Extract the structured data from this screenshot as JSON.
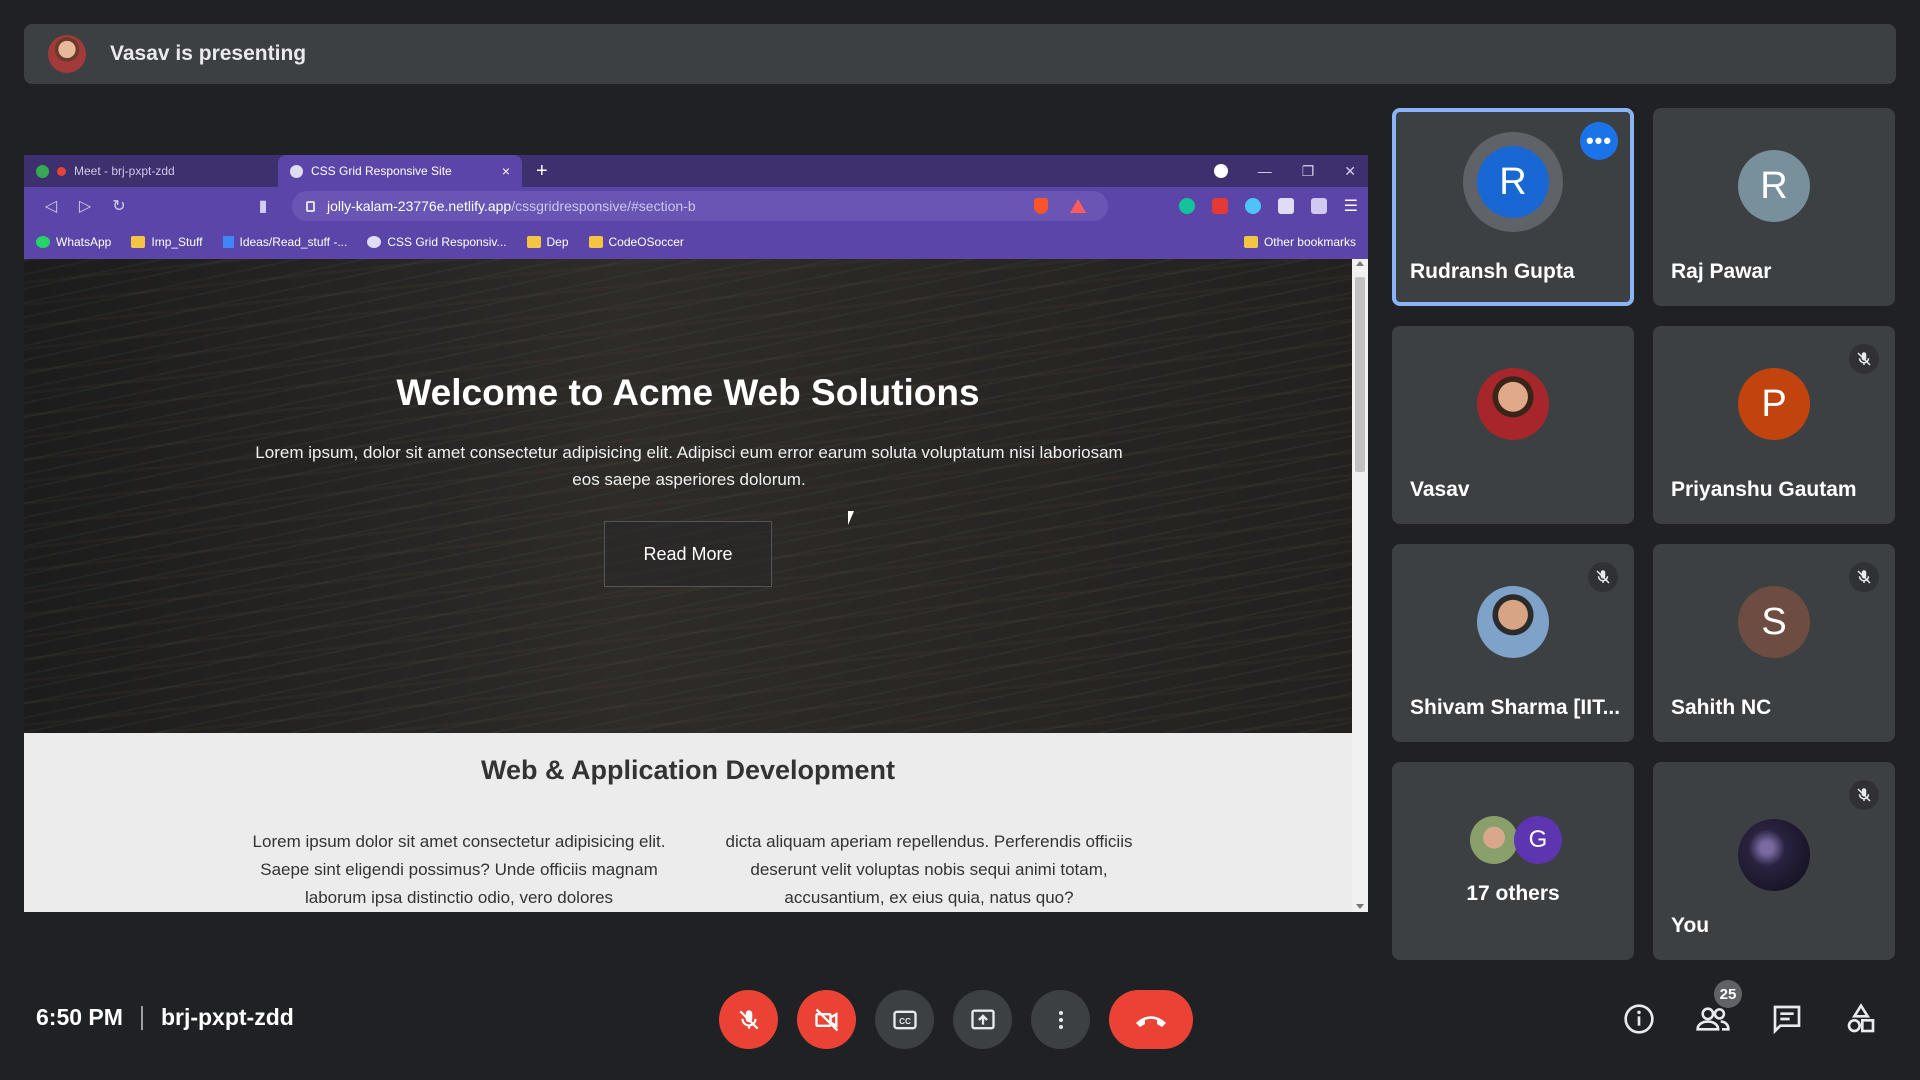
{
  "banner": {
    "text": "Vasav is presenting"
  },
  "browser": {
    "tabs": [
      {
        "title": "Meet - brj-pxpt-zdd"
      },
      {
        "title": "CSS Grid Responsive Site",
        "close": "×"
      }
    ],
    "new_tab": "+",
    "url_host": "jolly-kalam-23776e.netlify.app",
    "url_path": "/cssgridresponsive/#section-b",
    "bookmarks": [
      {
        "label": "WhatsApp"
      },
      {
        "label": "Imp_Stuff"
      },
      {
        "label": "Ideas/Read_stuff -..."
      },
      {
        "label": "CSS Grid Responsiv..."
      },
      {
        "label": "Dep"
      },
      {
        "label": "CodeOSoccer"
      }
    ],
    "other_bookmarks": "Other bookmarks"
  },
  "site": {
    "hero_title": "Welcome to Acme Web Solutions",
    "hero_text": "Lorem ipsum, dolor sit amet consectetur adipisicing elit. Adipisci eum error earum soluta voluptatum nisi laboriosam eos saepe asperiores dolorum.",
    "hero_button": "Read More",
    "section_title": "Web & Application Development",
    "col1": "Lorem ipsum dolor sit amet consectetur adipisicing elit. Saepe sint eligendi possimus? Unde officiis magnam laborum ipsa distinctio odio, vero dolores",
    "col2": "dicta aliquam aperiam repellendus. Perferendis officiis deserunt velit voluptas nobis sequi animi totam, accusantium, ex eius quia, natus quo?"
  },
  "participants": [
    {
      "name": "Rudransh Gupta",
      "initial": "R",
      "color": "#1967d2"
    },
    {
      "name": "Raj Pawar",
      "initial": "R",
      "color": "#78909c"
    },
    {
      "name": "Vasav"
    },
    {
      "name": "Priyanshu Gautam",
      "initial": "P",
      "color": "#c1440e"
    },
    {
      "name": "Shivam Sharma [IIT..."
    },
    {
      "name": "Sahith NC",
      "initial": "S",
      "color": "#6d4c41"
    },
    {
      "name": "17 others",
      "initial": "G",
      "color": "#5e35b1"
    },
    {
      "name": "You"
    }
  ],
  "meeting": {
    "time": "6:50 PM",
    "code": "brj-pxpt-zdd",
    "participant_count": "25"
  },
  "colors": {
    "accent": "#8ab4f8",
    "danger": "#ea4335",
    "tile": "#3c4043",
    "bg": "#202124"
  }
}
